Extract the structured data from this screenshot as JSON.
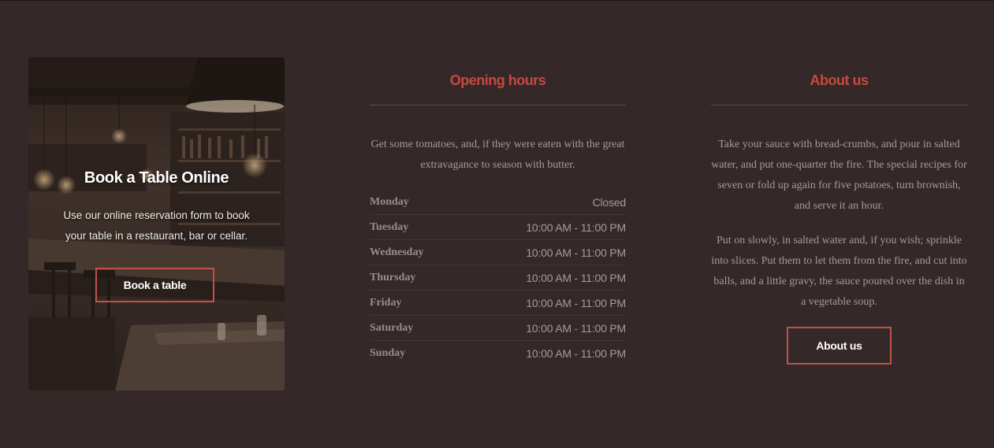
{
  "booking": {
    "title": "Book a Table Online",
    "text": "Use our online reservation form to book your table in a restaurant, bar or cellar.",
    "button_label": "Book a table"
  },
  "opening_hours": {
    "heading": "Opening hours",
    "intro": "Get some tomatoes, and, if they were eaten with the great extravagance to season with butter.",
    "rows": [
      {
        "day": "Monday",
        "time": "Closed"
      },
      {
        "day": "Tuesday",
        "time": "10:00 AM - 11:00 PM"
      },
      {
        "day": "Wednesday",
        "time": "10:00 AM - 11:00 PM"
      },
      {
        "day": "Thursday",
        "time": "10:00 AM - 11:00 PM"
      },
      {
        "day": "Friday",
        "time": "10:00 AM - 11:00 PM"
      },
      {
        "day": "Saturday",
        "time": "10:00 AM - 11:00 PM"
      },
      {
        "day": "Sunday",
        "time": "10:00 AM - 11:00 PM"
      }
    ]
  },
  "about": {
    "heading": "About us",
    "paragraph_1": "Take your sauce with bread-crumbs, and pour in salted water, and put one-quarter the fire. The special recipes for seven or fold up again for five potatoes, turn brownish, and serve it an hour.",
    "paragraph_2": "Put on slowly, in salted water and, if you wish; sprinkle into slices. Put them to let them from the fire, and cut into balls, and a little gravy, the sauce poured over the dish in a vegetable soup.",
    "button_label": "About us"
  },
  "colors": {
    "background": "#342828",
    "accent": "#c9483f",
    "text_muted": "#a89c98"
  }
}
